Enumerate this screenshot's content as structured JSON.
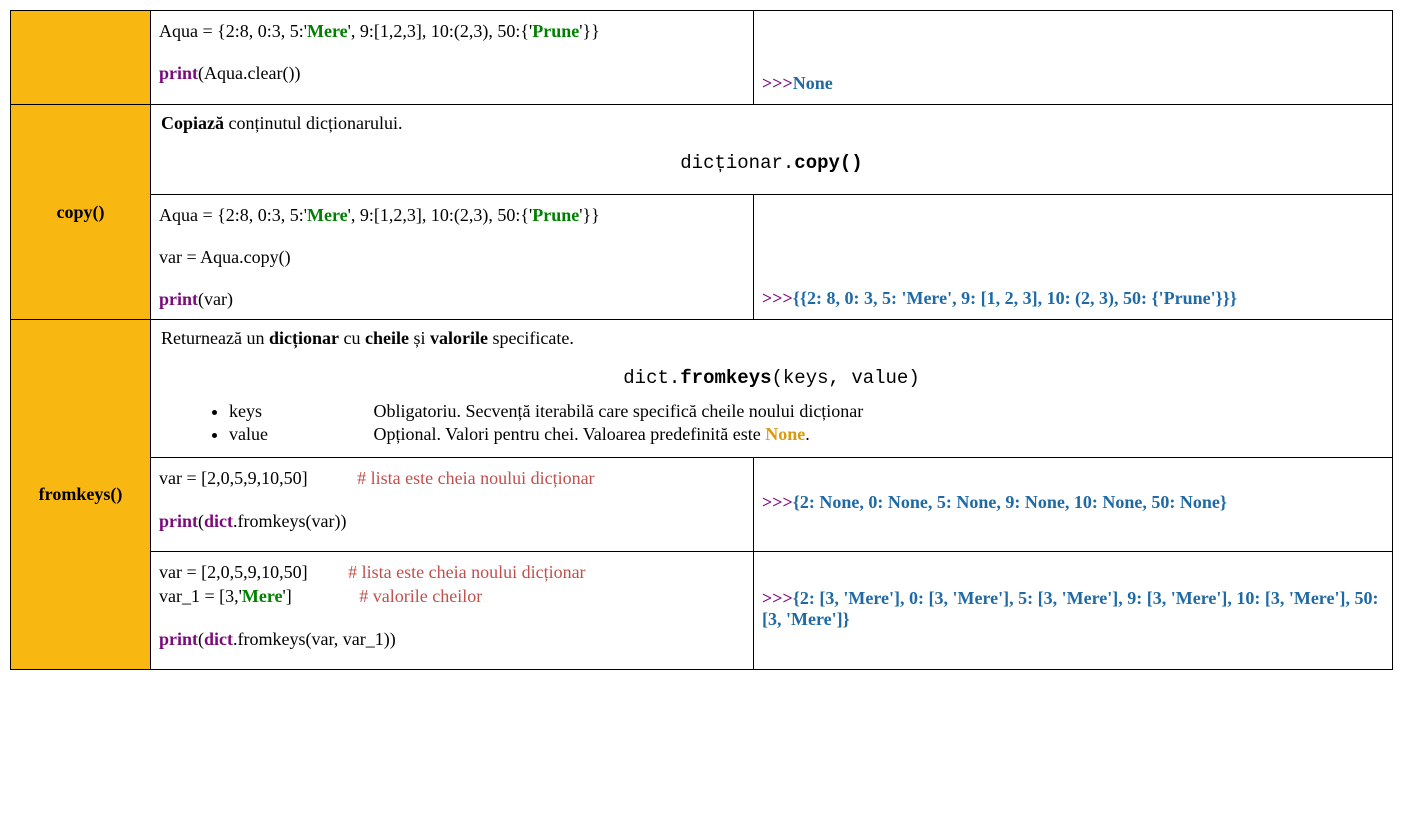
{
  "row1": {
    "method": "",
    "code": {
      "l1a": "Aqua = {2:8, 0:3, 5:'",
      "l1m": "Mere",
      "l1b": "', 9:[1,2,3], 10:(2,3), 50:{'",
      "l1p": "Prune",
      "l1c": "'}}",
      "print": "print",
      "l2": "(Aqua.clear())"
    },
    "out": {
      "prompt": ">>>",
      "val": "None"
    }
  },
  "row2": {
    "method": "copy()",
    "desc": {
      "b": "Copiază",
      "rest": " conținutul dicționarului."
    },
    "syntax": {
      "a": "dicționar.",
      "b": "copy()"
    },
    "code": {
      "l1a": "Aqua = {2:8, 0:3, 5:'",
      "l1m": "Mere",
      "l1b": "', 9:[1,2,3], 10:(2,3), 50:{'",
      "l1p": "Prune",
      "l1c": "'}}",
      "l2": "var = Aqua.copy()",
      "print": "print",
      "l3": "(var)"
    },
    "out": {
      "prompt": ">>>",
      "val": "{{2: 8, 0: 3, 5: 'Mere', 9: [1, 2, 3], 10: (2, 3), 50: {'Prune'}}}"
    }
  },
  "row3": {
    "method": "fromkeys()",
    "desc": {
      "a": "Returnează un ",
      "b1": "dicționar",
      "c": " cu ",
      "b2": "cheile",
      "d": " și ",
      "b3": "valorile",
      "e": " specificate."
    },
    "syntax": {
      "a": "dict.",
      "b": "fromkeys",
      "c": "(keys, value)"
    },
    "params": {
      "p1name": "keys",
      "p1desc": "Obligatoriu. Secvență iterabilă care specifică cheile noului dicționar",
      "p2name": "value",
      "p2desc_a": "Opțional. Valori pentru chei. Valoarea predefinită este ",
      "p2desc_none": "None",
      "p2desc_b": "."
    },
    "code1": {
      "l1a": "var = [2,0,5,9,10,50]",
      "l1pad": "           ",
      "l1cmt": "# lista este cheia noului dicționar",
      "print": "print",
      "l2a": "(",
      "dict": "dict",
      "l2b": ".fromkeys(var))"
    },
    "out1": {
      "prompt": ">>>",
      "val": "{2: None, 0: None, 5: None, 9: None, 10: None, 50: None}"
    },
    "code2": {
      "l1a": "var = [2,0,5,9,10,50]",
      "l1pad": "         ",
      "l1cmt": "# lista este cheia noului dicționar",
      "l2a": "var_1 = [3,'",
      "l2m": "Mere",
      "l2b": "']",
      "l2pad": "               ",
      "l2cmt": "# valorile cheilor",
      "print": "print",
      "l3a": "(",
      "dict": "dict",
      "l3b": ".fromkeys(var, var_1))"
    },
    "out2": {
      "prompt": ">>>",
      "val": "{2: [3, 'Mere'], 0: [3, 'Mere'], 5: [3, 'Mere'], 9: [3, 'Mere'], 10: [3, 'Mere'], 50: [3, 'Mere']}"
    }
  }
}
